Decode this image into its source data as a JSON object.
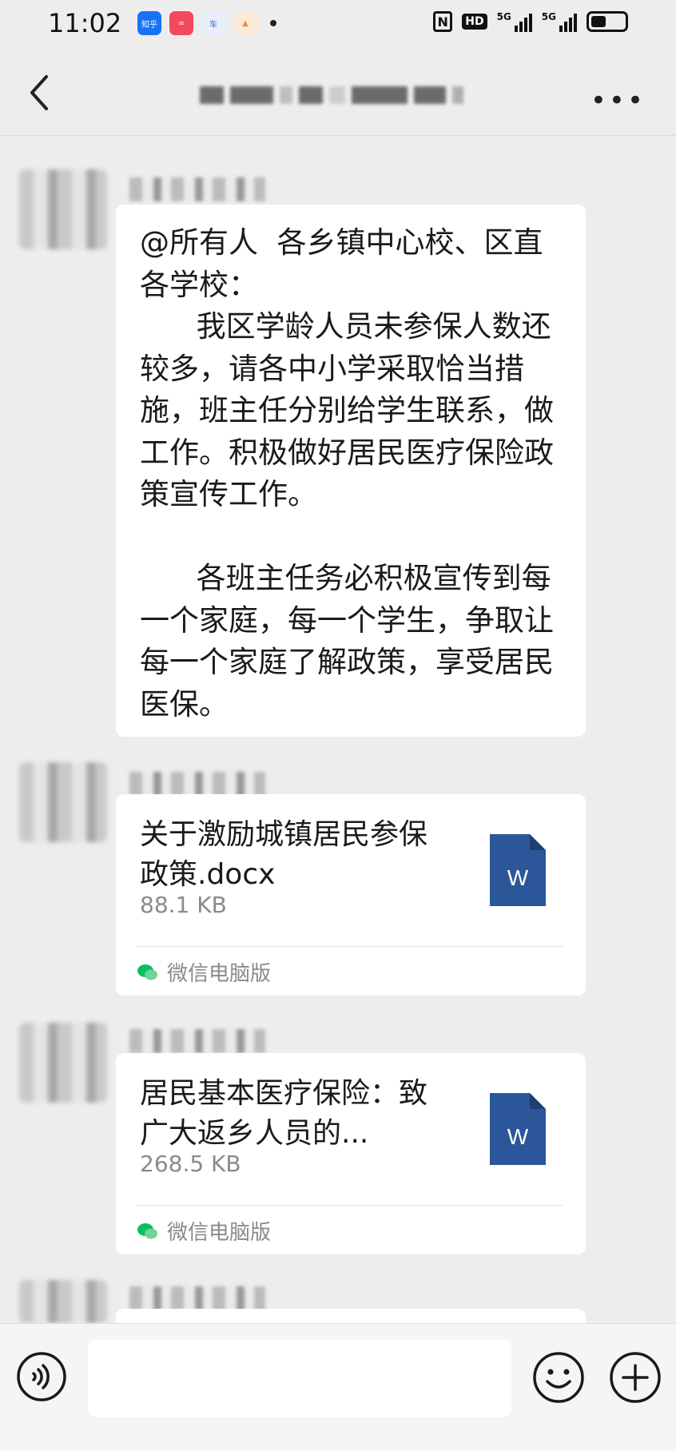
{
  "status_bar": {
    "time": "11:02",
    "apps": [
      {
        "label": "知乎",
        "color": "#1772f6"
      },
      {
        "label": "∞",
        "color": "#f24a5a"
      },
      {
        "label": "车",
        "color": "#2b6fd6"
      },
      {
        "label": "▲",
        "color": "#f08a3c"
      }
    ],
    "nfc": "N",
    "hd": "HD",
    "network1": "5G",
    "network2": "5G"
  },
  "messages": [
    {
      "type": "text",
      "text": "@所有人  各乡镇中心校、区直各学校：\n      我区学龄人员未参保人数还较多，请各中小学采取恰当措施，班主任分别给学生联系，做工作。积极做好居民医疗保险政策宣传工作。\n\n      各班主任务必积极宣传到每一个家庭，每一个学生，争取让每一个家庭了解政策，享受居民医保。"
    },
    {
      "type": "file",
      "name": "关于激励城镇居民参保政策.docx",
      "size": "88.1 KB",
      "source": "微信电脑版",
      "file_icon": "word-doc-icon"
    },
    {
      "type": "file",
      "name": "居民基本医疗保险：致广大返乡人员的...",
      "size": "268.5 KB",
      "source": "微信电脑版",
      "file_icon": "word-doc-icon"
    }
  ],
  "word_icon_letter": "W",
  "colors": {
    "background": "#ededed",
    "bubble": "#ffffff",
    "word_blue": "#2b579a",
    "wechat_green": "#07c160"
  }
}
